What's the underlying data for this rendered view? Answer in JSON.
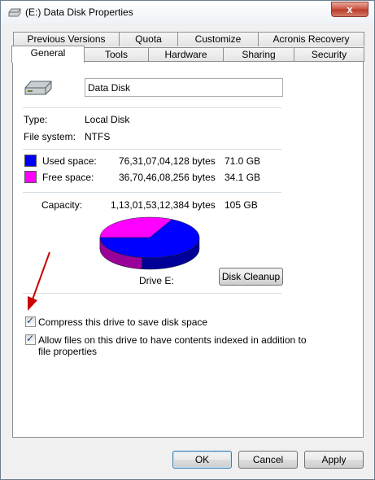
{
  "window": {
    "title": "(E:) Data Disk Properties",
    "close_label": "x"
  },
  "tabs_row1": [
    "Previous Versions",
    "Quota",
    "Customize",
    "Acronis Recovery"
  ],
  "tabs_row2": [
    "General",
    "Tools",
    "Hardware",
    "Sharing",
    "Security"
  ],
  "active_tab": "General",
  "general": {
    "disk_name_value": "Data Disk",
    "type_label": "Type:",
    "type_value": "Local Disk",
    "fs_label": "File system:",
    "fs_value": "NTFS",
    "used_label": "Used space:",
    "used_bytes": "76,31,07,04,128 bytes",
    "used_size": "71.0 GB",
    "free_label": "Free space:",
    "free_bytes": "36,70,46,08,256 bytes",
    "free_size": "34.1 GB",
    "capacity_label": "Capacity:",
    "capacity_bytes": "1,13,01,53,12,384 bytes",
    "capacity_size": "105 GB",
    "drive_label": "Drive E:",
    "cleanup_button": "Disk Cleanup",
    "compress_label": "Compress this drive to save disk space",
    "compress_checked": true,
    "index_label_line1": "Allow files on this drive to have contents indexed in addition to",
    "index_label_line2": "file properties",
    "index_checked": true
  },
  "pie": {
    "used_fraction": 0.676,
    "free_fraction": 0.324
  },
  "colors": {
    "used": "#0000ff",
    "free": "#ff00ff",
    "annotation_arrow": "#cc0000"
  },
  "buttons": {
    "ok": "OK",
    "cancel": "Cancel",
    "apply": "Apply"
  }
}
